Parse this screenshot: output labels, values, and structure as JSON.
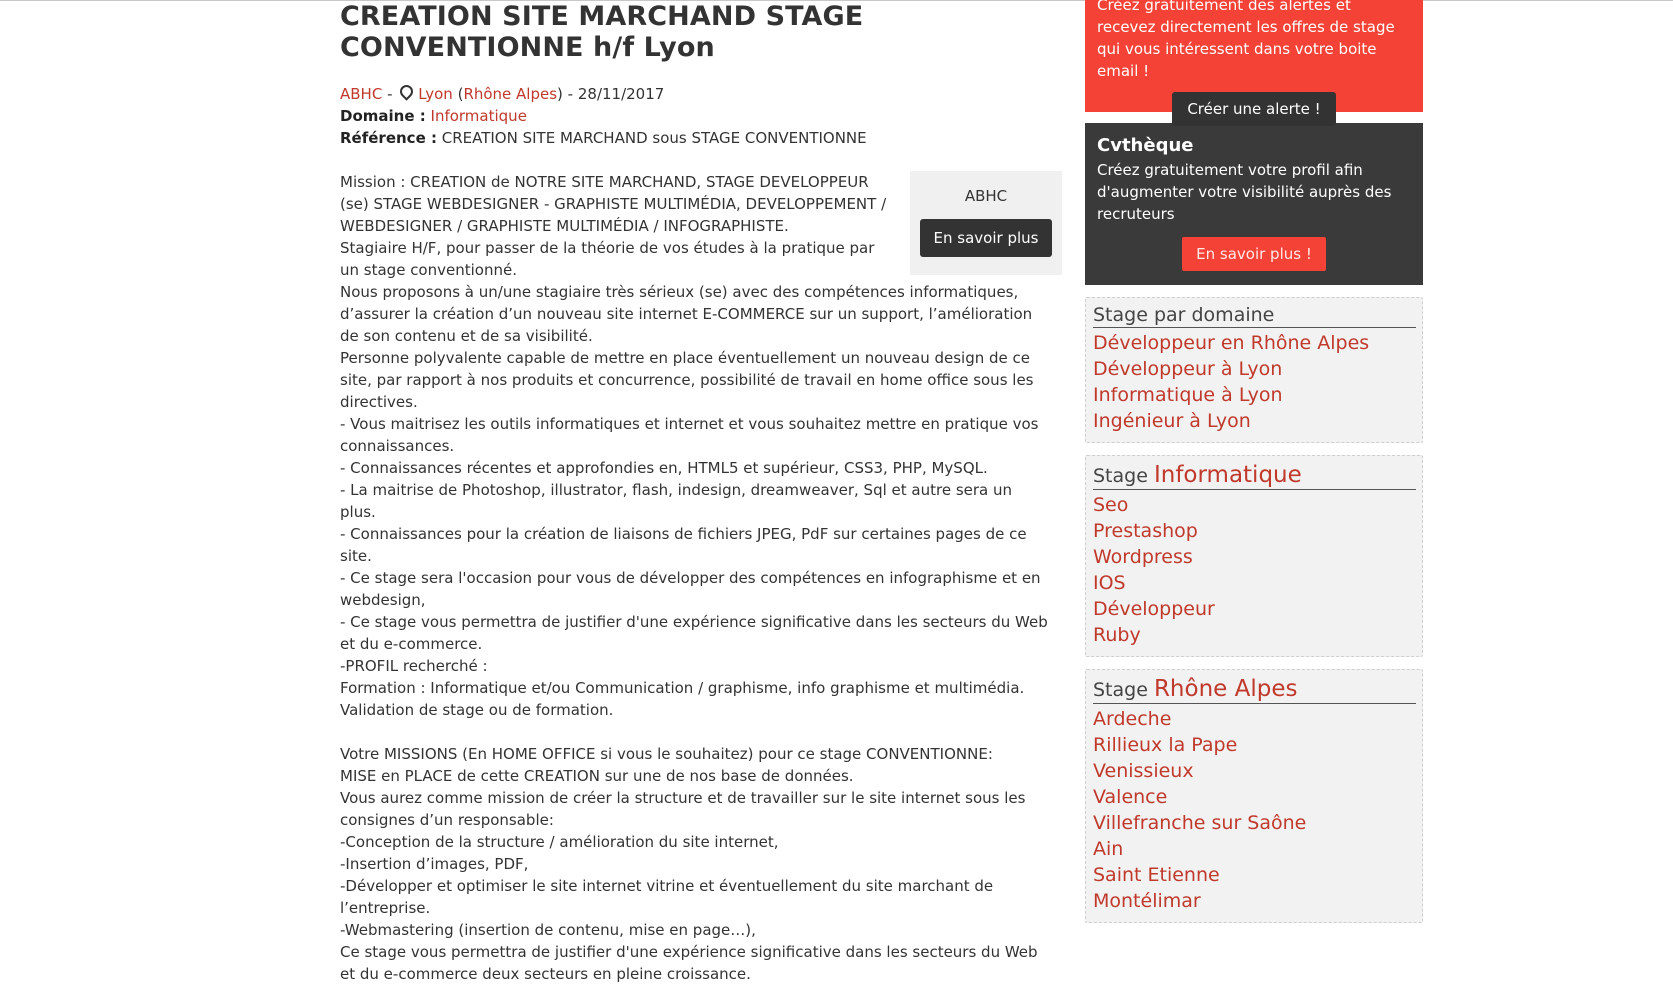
{
  "job": {
    "title": "CREATION SITE MARCHAND STAGE CONVENTIONNE h/f Lyon",
    "company": "ABHC",
    "separator": " - ",
    "city": "Lyon",
    "region": "Rhône Alpes",
    "date": " - 28/11/2017",
    "domain_label": "Domaine :",
    "domain": "Informatique",
    "reference_label": "Référence :",
    "reference": "CREATION SITE MARCHAND sous STAGE CONVENTIONNE"
  },
  "company_box": {
    "name": "ABHC",
    "button": "En savoir plus"
  },
  "description": [
    "Mission : CREATION de NOTRE SITE MARCHAND, STAGE DEVELOPPEUR (se) STAGE WEBDESIGNER - GRAPHISTE MULTIMÉDIA, DEVELOPPEMENT / WEBDESIGNER / GRAPHISTE MULTIMÉDIA / INFOGRAPHISTE.",
    "Stagiaire H/F, pour passer de la théorie de vos études à la pratique par un stage conventionné.",
    "Nous proposons à un/une stagiaire très sérieux (se) avec des compétences informatiques, d’assurer la création d’un nouveau site internet E-COMMERCE sur un support, l’amélioration de son contenu et de sa visibilité.",
    "Personne polyvalente capable de mettre en place éventuellement un nouveau design de ce site, par rapport à nos produits et concurrence, possibilité de travail en home office sous les directives.",
    "- Vous maitrisez les outils informatiques et internet et vous souhaitez mettre en pratique vos connaissances.",
    "- Connaissances récentes et approfondies en, HTML5 et supérieur, CSS3, PHP, MySQL.",
    "- La maitrise de Photoshop, illustrator, flash, indesign, dreamweaver, Sql et autre sera un plus.",
    "- Connaissances pour la création de liaisons de fichiers JPEG, PdF sur certaines pages de ce site.",
    "- Ce stage sera l'occasion pour vous de développer des compétences en infographisme et en webdesign,",
    "- Ce stage vous permettra de justifier d'une expérience significative dans les secteurs du Web et du e-commerce.",
    "-PROFIL recherché :",
    "Formation : Informatique et/ou Communication / graphisme, info graphisme et multimédia.",
    "Validation de stage ou de formation.",
    "",
    "Votre MISSIONS (En HOME OFFICE si vous le souhaitez) pour ce stage CONVENTIONNE:",
    "MISE en PLACE de cette CREATION sur une de nos base de données.",
    "Vous aurez comme mission de créer la structure et de travailler sur le site internet sous les consignes d’un responsable:",
    "-Conception de la structure / amélioration du site internet,",
    "-Insertion d’images, PDF,",
    "-Développer et optimiser le site internet vitrine et éventuellement du site marchant de l’entreprise.",
    "-Webmastering (insertion de contenu, mise en page…),",
    "Ce stage vous permettra de justifier d'une expérience significative dans les secteurs du Web et du e-commerce deux secteurs en pleine croissance."
  ],
  "sidebar": {
    "alert": {
      "text": "Créez gratuitement des alertes et recevez directement les offres de stage qui vous intéressent dans votre boite email !",
      "button": "Créer une alerte !"
    },
    "cvtheque": {
      "title": "Cvthèque",
      "text": "Créez gratuitement votre profil afin d'augmenter votre visibilité auprès des recruteurs",
      "button": "En savoir plus !"
    },
    "by_domain": {
      "title": "Stage par domaine",
      "items": [
        "Développeur en Rhône Alpes",
        "Développeur à Lyon",
        "Informatique à Lyon",
        "Ingénieur à Lyon"
      ]
    },
    "informatique": {
      "prefix": "Stage ",
      "highlight": "Informatique",
      "items": [
        "Seo",
        "Prestashop",
        "Wordpress",
        "IOS",
        "Développeur",
        "Ruby"
      ]
    },
    "region": {
      "prefix": "Stage ",
      "highlight": "Rhône Alpes",
      "items": [
        "Ardeche",
        "Rillieux la Pape",
        "Venissieux",
        "Valence",
        "Villefranche sur Saône",
        "Ain",
        "Saint Etienne",
        "Montélimar"
      ]
    }
  }
}
